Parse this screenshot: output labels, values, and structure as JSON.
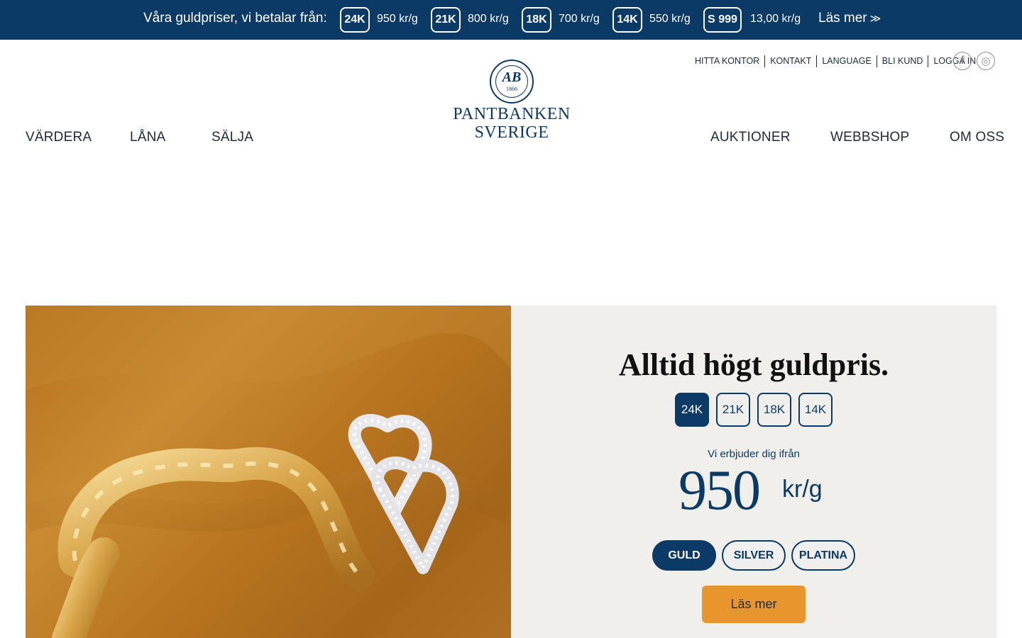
{
  "price_bar": {
    "title": "Våra guldpriser, vi betalar från:",
    "items": [
      {
        "badge": "24K",
        "price": "950 kr/g"
      },
      {
        "badge": "21K",
        "price": "800 kr/g"
      },
      {
        "badge": "18K",
        "price": "700 kr/g"
      },
      {
        "badge": "14K",
        "price": "550 kr/g"
      },
      {
        "badge": "S 999",
        "price": "13,00 kr/g"
      }
    ],
    "more_label": "Läs mer",
    "more_icon": "double-chevron-right-icon",
    "background": "#0c3a66"
  },
  "utility_nav": [
    "HITTA KONTOR",
    "KONTAKT",
    "LANGUAGE",
    "BLI KUND",
    "LOGGA IN"
  ],
  "social": [
    {
      "icon": "facebook-icon",
      "glyph": "f"
    },
    {
      "icon": "instagram-icon",
      "glyph": "◎"
    }
  ],
  "logo": {
    "line1": "PANTBANKEN",
    "line2": "SVERIGE",
    "monogram": "AB",
    "year": "1866"
  },
  "main_nav": {
    "left": [
      "VÄRDERA",
      "LÅNA",
      "SÄLJA"
    ],
    "right": [
      "AUKTIONER",
      "WEBBSHOP",
      "OM OSS"
    ]
  },
  "hero": {
    "title": "Alltid högt guldpris.",
    "karats": [
      "24K",
      "21K",
      "18K",
      "14K"
    ],
    "selected_karat": "24K",
    "offer_label": "Vi erbjuder dig ifrån",
    "price": "950",
    "unit": "kr/g",
    "metals": [
      "GULD",
      "SILVER",
      "PLATINA"
    ],
    "selected_metal": "GULD",
    "cta_label": "Läs mer",
    "image": "gold-bracelet-and-diamond-earrings",
    "colors": {
      "accent": "#0c3a66",
      "cta": "#e8952e",
      "panel": "#f1efeb"
    }
  }
}
